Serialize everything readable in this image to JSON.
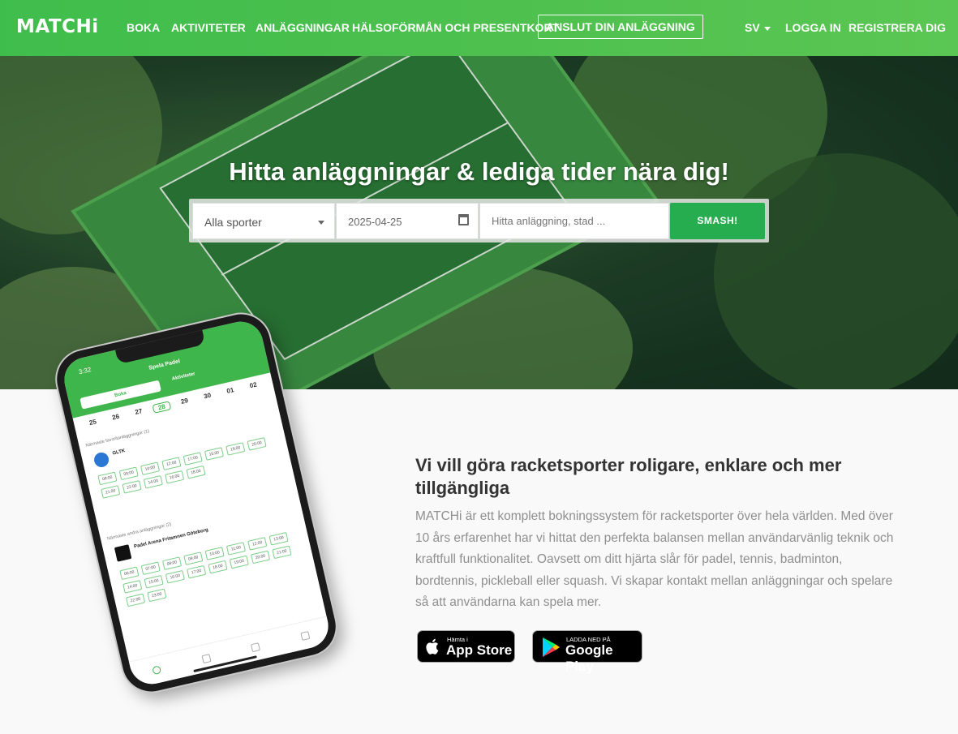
{
  "nav": {
    "logo": "MATCHi",
    "items": [
      "BOKA",
      "AKTIVITETER",
      "ANLÄGGNINGAR",
      "HÄLSOFÖRMÅN OCH PRESENTKORT"
    ],
    "cta": "ANSLUT DIN ANLÄGGNING",
    "language": "SV",
    "login": "LOGGA IN",
    "register": "REGISTRERA DIG"
  },
  "hero": {
    "title": "Hitta anläggningar & lediga tider nära dig!",
    "sport_select": "Alla sporter",
    "date": "2025-04-25",
    "search_placeholder": "Hitta anläggning, stad ...",
    "search_button": "SMASH!"
  },
  "phone": {
    "time": "3:32",
    "title": "Spela Padel",
    "tab_active": "Boka",
    "tab_other": "Aktiviteter",
    "days": [
      "25",
      "26",
      "27",
      "28",
      "29",
      "30",
      "01",
      "02"
    ],
    "section1": "Närmaste favoritanläggningar (1)",
    "venue1": "GLTK",
    "section2": "Närmaste andra anläggningar (2)",
    "venue2": "Padel Arena Fritamnen Göteborg",
    "slots1": [
      "08:00",
      "09:00",
      "10:00",
      "12:00",
      "17:00",
      "15:00",
      "19:00",
      "20:00",
      "21:00",
      "22:00",
      "14:00",
      "16:00",
      "18:00"
    ],
    "slots2": [
      "06:00",
      "07:00",
      "08:00",
      "09:00",
      "10:00",
      "11:00",
      "12:00",
      "13:00",
      "14:00",
      "15:00",
      "16:00",
      "17:00",
      "18:00",
      "19:00",
      "20:00",
      "21:00",
      "22:00",
      "23:00"
    ]
  },
  "content": {
    "heading": "Vi vill göra racketsporter roligare, enklare och mer tillgängliga",
    "paragraph": "MATCHi är ett komplett bokningssystem för racketsporter över hela världen. Med över 10 års erfarenhet har vi hittat den perfekta balansen mellan användarvänlig teknik och kraftfull funktionalitet. Oavsett om ditt hjärta slår för padel, tennis, badminton, bordtennis, pickleball eller squash. Vi skapar kontakt mellan anläggningar och spelare så att användarna kan spela mer."
  },
  "stores": {
    "apple_small": "Hämta i",
    "apple_big": "App Store",
    "google_small": "LADDA NED PÅ",
    "google_big": "Google Play"
  },
  "colors": {
    "brand": "#4cbf4f",
    "button": "#26ad4f"
  }
}
